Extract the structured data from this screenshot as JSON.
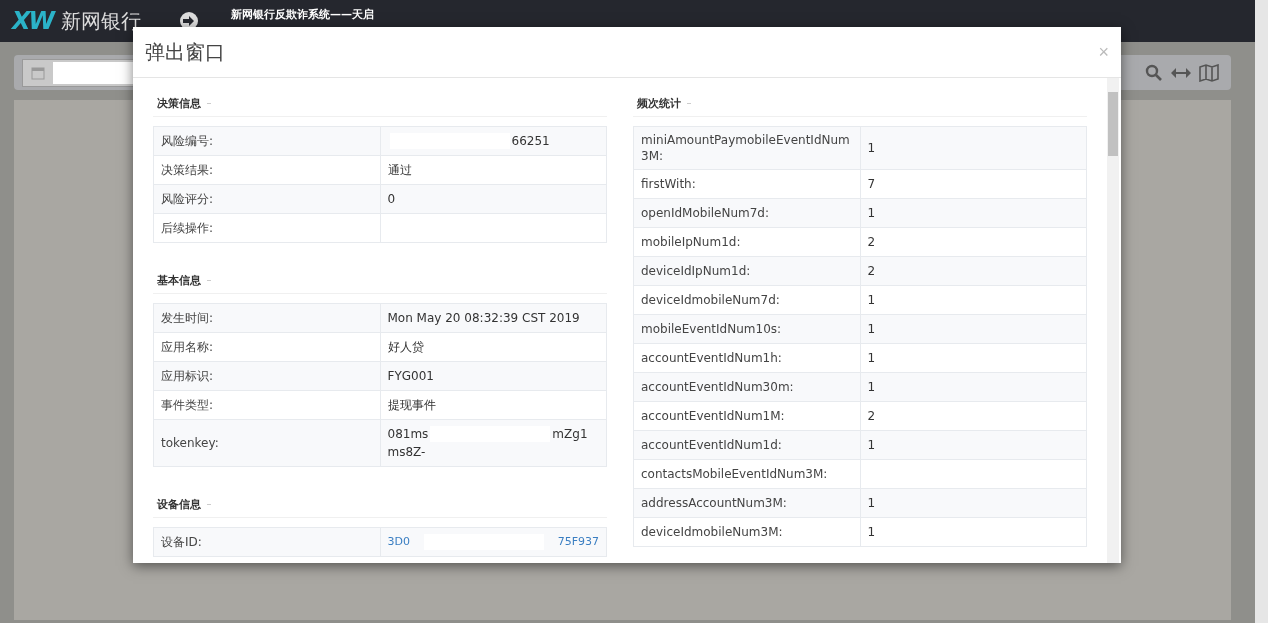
{
  "header": {
    "logo": "XW",
    "brand": "新网银行",
    "title": "新网银行反欺诈系统——天启"
  },
  "modal": {
    "title": "弹出窗口",
    "close": "×",
    "left_sections": [
      {
        "title": "决策信息",
        "rows": [
          {
            "label": "风险编号:",
            "kind": "redacted",
            "value_start": "",
            "value_end": "66251"
          },
          {
            "label": "决策结果:",
            "kind": "text",
            "value": "通过"
          },
          {
            "label": "风险评分:",
            "kind": "text",
            "value": "0"
          },
          {
            "label": "后续操作:",
            "kind": "text",
            "value": ""
          }
        ]
      },
      {
        "title": "基本信息",
        "rows": [
          {
            "label": "发生时间:",
            "kind": "text",
            "value": "Mon May 20 08:32:39 CST 2019"
          },
          {
            "label": "应用名称:",
            "kind": "text",
            "value": "好人贷"
          },
          {
            "label": "应用标识:",
            "kind": "text",
            "value": "FYG001"
          },
          {
            "label": "事件类型:",
            "kind": "text",
            "value": "提现事件"
          },
          {
            "label": "tokenkey:",
            "kind": "redacted",
            "value_start": "081ms",
            "value_end": "mZg1",
            "value_next": "ms8Z-"
          }
        ]
      },
      {
        "title": "设备信息",
        "rows": [
          {
            "label": "设备ID:",
            "kind": "link",
            "value_start": "3D0",
            "value_end": "75F937"
          }
        ]
      }
    ],
    "right_section": {
      "title": "频次统计",
      "rows": [
        {
          "label": "miniAmountPaymobileEventIdNum3M:",
          "value": "1"
        },
        {
          "label": "firstWith:",
          "value": "7"
        },
        {
          "label": "openIdMobileNum7d:",
          "value": "1"
        },
        {
          "label": "mobileIpNum1d:",
          "value": "2"
        },
        {
          "label": "deviceIdIpNum1d:",
          "value": "2"
        },
        {
          "label": "deviceIdmobileNum7d:",
          "value": "1"
        },
        {
          "label": "mobileEventIdNum10s:",
          "value": "1"
        },
        {
          "label": "accountEventIdNum1h:",
          "value": "1"
        },
        {
          "label": "accountEventIdNum30m:",
          "value": "1"
        },
        {
          "label": "accountEventIdNum1M:",
          "value": "2"
        },
        {
          "label": "accountEventIdNum1d:",
          "value": "1"
        },
        {
          "label": "contactsMobileEventIdNum3M:",
          "value": ""
        },
        {
          "label": "addressAccountNum3M:",
          "value": "1"
        },
        {
          "label": "deviceIdmobileNum3M:",
          "value": "1"
        }
      ]
    }
  }
}
